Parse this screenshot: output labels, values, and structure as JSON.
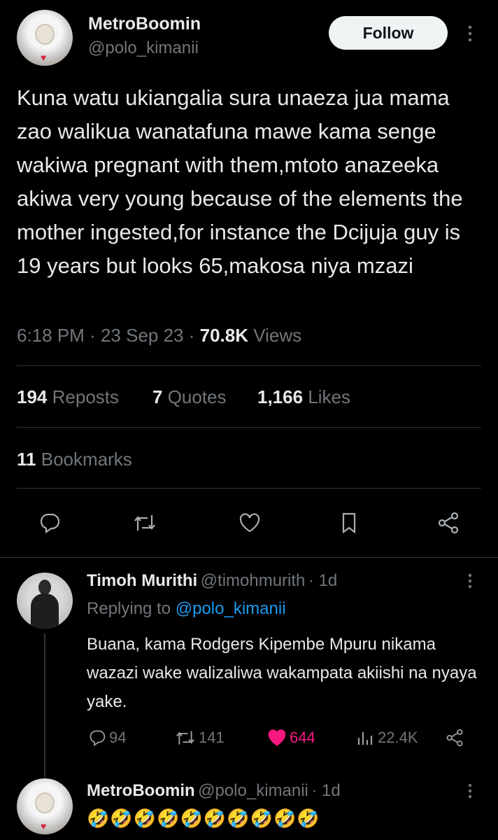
{
  "tweet": {
    "author_name": "MetroBoomin",
    "author_handle": "@polo_kimanii",
    "follow_label": "Follow",
    "text": "Kuna watu ukiangalia sura unaeza jua mama zao walikua wanatafuna mawe kama senge wakiwa pregnant with them,mtoto anazeeka akiwa very young because of the elements the mother ingested,for instance the Dcijuja guy is 19 years but looks 65,makosa niya mzazi",
    "time": "6:18 PM",
    "date": "23 Sep 23",
    "views_count": "70.8K",
    "views_label": "Views",
    "reposts_count": "194",
    "reposts_label": "Reposts",
    "quotes_count": "7",
    "quotes_label": "Quotes",
    "likes_count": "1,166",
    "likes_label": "Likes",
    "bookmarks_count": "11",
    "bookmarks_label": "Bookmarks",
    "action_icons": [
      "reply-icon",
      "repost-icon",
      "like-icon",
      "bookmark-icon",
      "share-icon"
    ]
  },
  "reply": {
    "author_name": "Timoh Murithi",
    "author_handle": "@timohmurith",
    "age": "· 1d",
    "replying_to_label": "Replying to",
    "replying_to_handle": "@polo_kimanii",
    "text": "Buana, kama Rodgers Kipembe Mpuru nikama wazazi wake walizaliwa wakampata akiishi na nyaya yake.",
    "reply_count": "94",
    "repost_count": "141",
    "like_count": "644",
    "views_count": "22.4K",
    "like_color": "#f91880"
  },
  "second_reply": {
    "author_name": "MetroBoomin",
    "author_handle": "@polo_kimanii",
    "age": "· 1d",
    "text": "🤣🤣🤣🤣🤣🤣🤣🤣🤣🤣"
  },
  "colors": {
    "background": "#000000",
    "primary_text": "#e7e9ea",
    "secondary_text": "#71767b",
    "link": "#1d9bf0",
    "divider": "#2f3336"
  }
}
